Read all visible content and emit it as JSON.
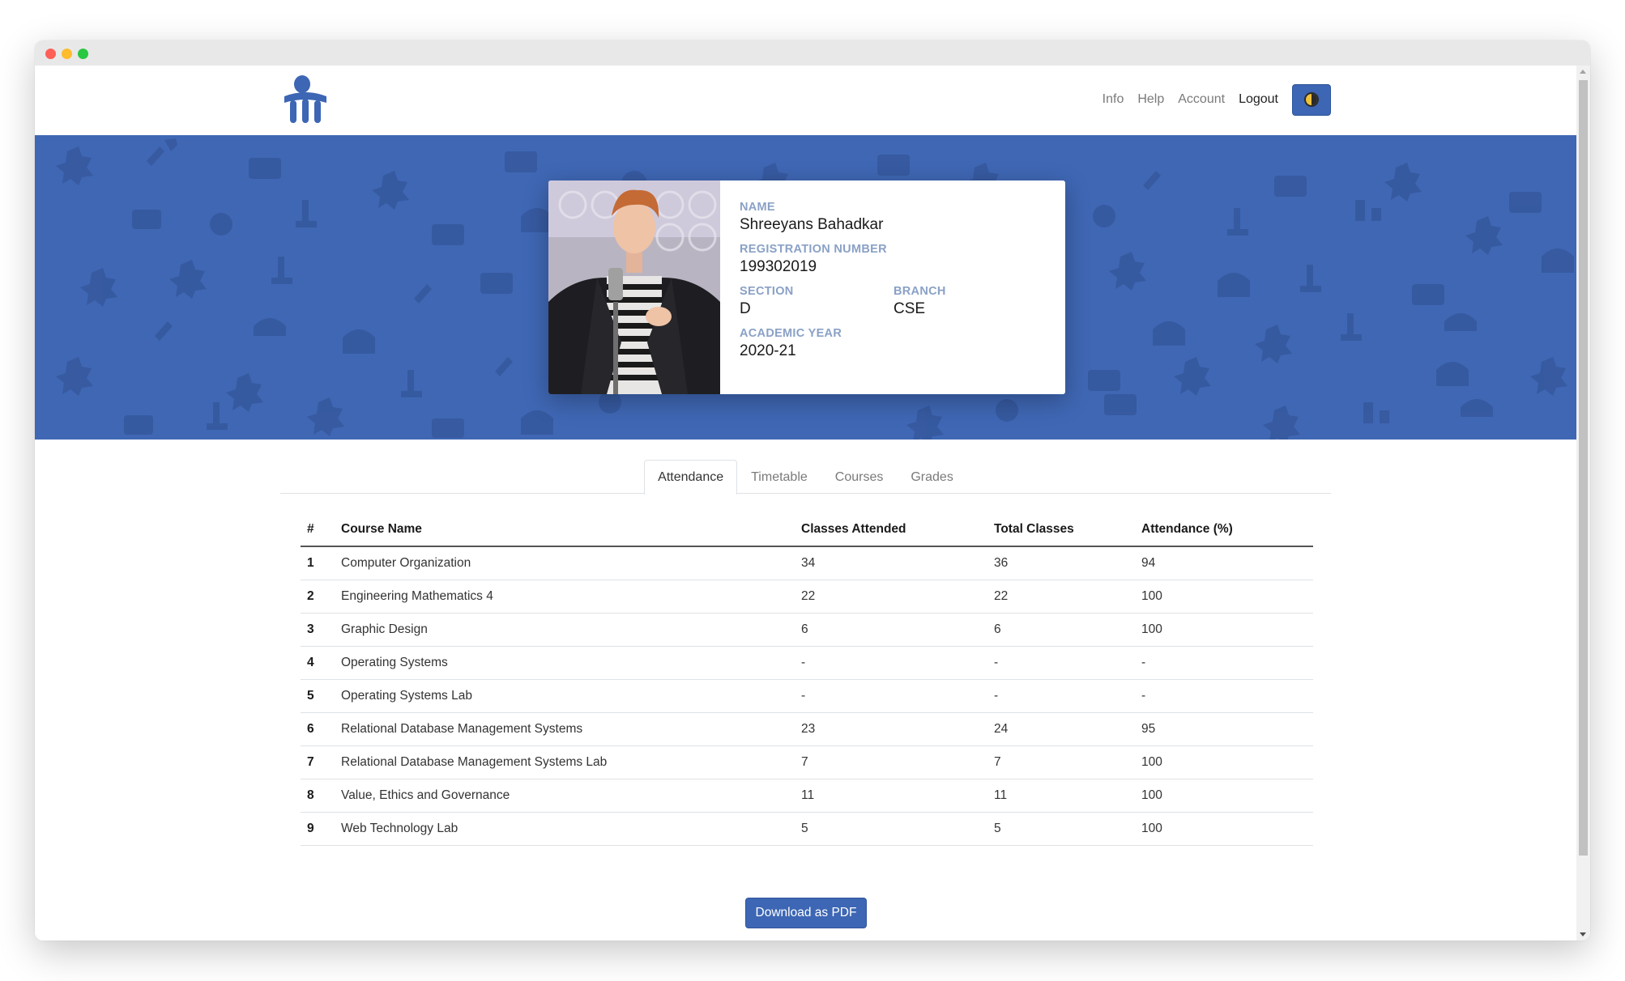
{
  "nav": {
    "links": [
      "Info",
      "Help",
      "Account",
      "Logout"
    ]
  },
  "profile": {
    "name_label": "NAME",
    "name": "Shreeyans Bahadkar",
    "reg_label": "REGISTRATION NUMBER",
    "reg_number": "199302019",
    "section_label": "SECTION",
    "section": "D",
    "branch_label": "BRANCH",
    "branch": "CSE",
    "year_label": "ACADEMIC YEAR",
    "year": "2020-21"
  },
  "tabs": [
    "Attendance",
    "Timetable",
    "Courses",
    "Grades"
  ],
  "table": {
    "headers": [
      "#",
      "Course Name",
      "Classes Attended",
      "Total Classes",
      "Attendance (%)"
    ],
    "rows": [
      [
        "1",
        "Computer Organization",
        "34",
        "36",
        "94"
      ],
      [
        "2",
        "Engineering Mathematics 4",
        "22",
        "22",
        "100"
      ],
      [
        "3",
        "Graphic Design",
        "6",
        "6",
        "100"
      ],
      [
        "4",
        "Operating Systems",
        "-",
        "-",
        "-"
      ],
      [
        "5",
        "Operating Systems Lab",
        "-",
        "-",
        "-"
      ],
      [
        "6",
        "Relational Database Management Systems",
        "23",
        "24",
        "95"
      ],
      [
        "7",
        "Relational Database Management Systems Lab",
        "7",
        "7",
        "100"
      ],
      [
        "8",
        "Value, Ethics and Governance",
        "11",
        "11",
        "100"
      ],
      [
        "9",
        "Web Technology Lab",
        "5",
        "5",
        "100"
      ]
    ]
  },
  "download_label": "Download as PDF",
  "colors": {
    "brand": "#3f67b4",
    "button": "#3d66b4"
  },
  "icons": {
    "logo": "app-logo-icon",
    "theme": "moon-icon"
  }
}
